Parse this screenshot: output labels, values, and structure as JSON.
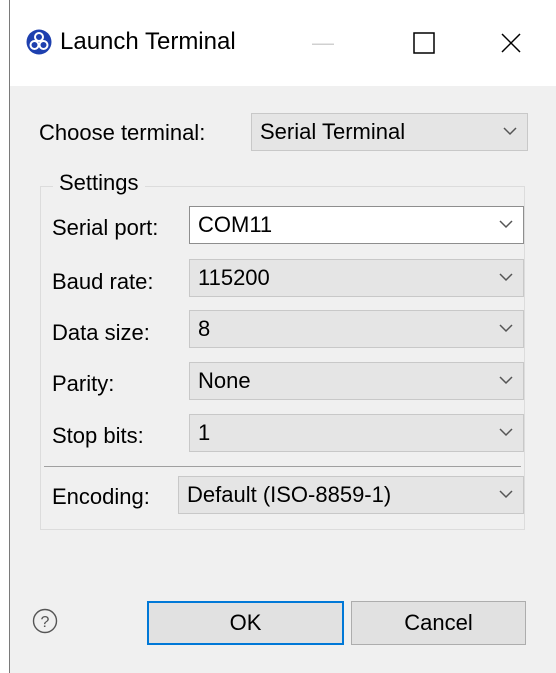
{
  "window": {
    "title": "Launch Terminal",
    "minimize_glyph": "—",
    "app_icon": "eclipse-icon"
  },
  "terminal": {
    "label": "Choose terminal:",
    "value": "Serial Terminal"
  },
  "settings": {
    "title": "Settings",
    "serial_port": {
      "label": "Serial port:",
      "value": "COM11"
    },
    "baud_rate": {
      "label": "Baud rate:",
      "value": "115200"
    },
    "data_size": {
      "label": "Data size:",
      "value": "8"
    },
    "parity": {
      "label": "Parity:",
      "value": "None"
    },
    "stop_bits": {
      "label": "Stop bits:",
      "value": "1"
    }
  },
  "encoding": {
    "label": "Encoding:",
    "value": "Default (ISO-8859-1)"
  },
  "buttons": {
    "ok": "OK",
    "cancel": "Cancel"
  },
  "help": {
    "glyph": "?"
  },
  "colors": {
    "accent": "#0078d7",
    "icon": "#1e40af",
    "dialog_bg": "#f0f0f0"
  }
}
